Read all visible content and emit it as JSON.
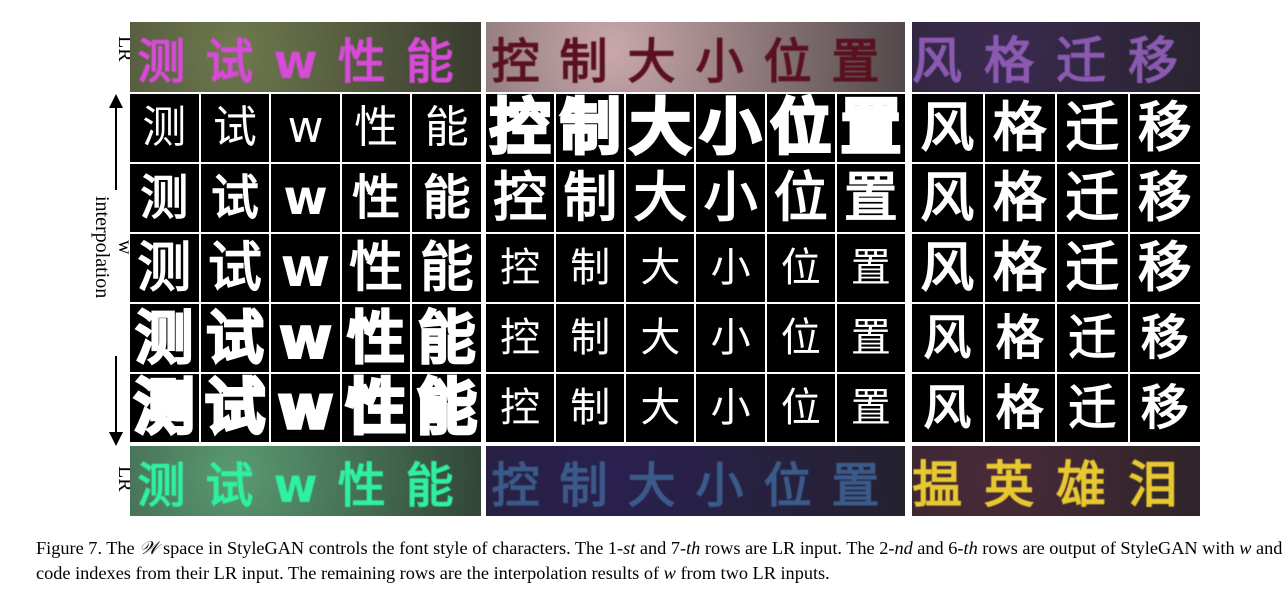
{
  "side_labels": {
    "top": "LR",
    "middle": "w interpolation",
    "bottom": "LR"
  },
  "panels": [
    {
      "lr_top": {
        "text": "测试w性能",
        "color": "#d84ad8",
        "bg": "#6f7a4e"
      },
      "rows": [
        [
          "测",
          "试",
          "w",
          "性",
          "能"
        ],
        [
          "测",
          "试",
          "w",
          "性",
          "能"
        ],
        [
          "测",
          "试",
          "w",
          "性",
          "能"
        ],
        [
          "测",
          "试",
          "w",
          "性",
          "能"
        ],
        [
          "测",
          "试",
          "w",
          "性",
          "能"
        ]
      ],
      "lr_bottom": {
        "text": "测试w性能",
        "color": "#2ff0a0",
        "bg": "#5a9a70"
      }
    },
    {
      "lr_top": {
        "text": "控制大小位置",
        "color": "#5a1020",
        "bg": "#c9a8ac"
      },
      "rows": [
        [
          "控",
          "制",
          "大",
          "小",
          "位",
          "置"
        ],
        [
          "控",
          "制",
          "大",
          "小",
          "位",
          "置"
        ],
        [
          "控",
          "制",
          "大",
          "小",
          "位",
          "置"
        ],
        [
          "控",
          "制",
          "大",
          "小",
          "位",
          "置"
        ],
        [
          "控",
          "制",
          "大",
          "小",
          "位",
          "置"
        ]
      ],
      "lr_bottom": {
        "text": "控制大小位置",
        "color": "#3a5a8a",
        "bg": "#2a2050"
      }
    },
    {
      "lr_top": {
        "text": "风格迁移",
        "color": "#8a5ab0",
        "bg": "#3a2a50"
      },
      "rows": [
        [
          "风",
          "格",
          "迁",
          "移"
        ],
        [
          "风",
          "格",
          "迁",
          "移"
        ],
        [
          "风",
          "格",
          "迁",
          "移"
        ],
        [
          "风",
          "格",
          "迁",
          "移"
        ],
        [
          "风",
          "格",
          "迁",
          "移"
        ]
      ],
      "lr_bottom": {
        "text": "揾英雄泪",
        "color": "#e8c830",
        "bg": "#4a2a3a"
      }
    }
  ],
  "caption": {
    "prefix": "Figure 7. The ",
    "symbol": "𝒲",
    "s1": " space in StyleGAN controls the font style of characters. The 1-",
    "st": "st",
    "s2": " and 7-",
    "th": "th",
    "s3": " rows are LR input. The 2-",
    "nd": "nd",
    "s4": " and 6-",
    "th2": "th",
    "s5": " rows are output of StyleGAN with ",
    "w": "w",
    "s6": " and code indexes from their LR input. The remaining rows are the interpolation results of ",
    "w2": "w",
    "s7": " from two LR inputs."
  }
}
